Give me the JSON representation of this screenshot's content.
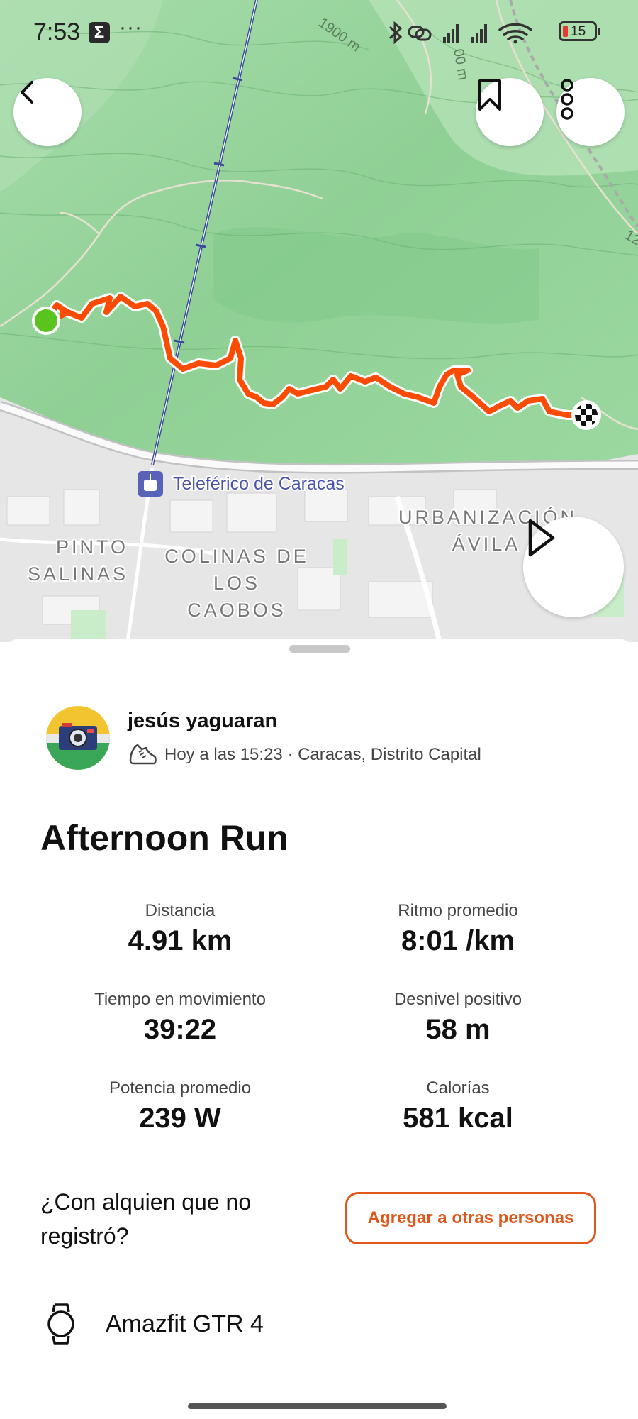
{
  "status_bar": {
    "time": "7:53",
    "notification_icon": "sigma-icon",
    "more": "···",
    "battery_level": "15",
    "icons": [
      "bluetooth-icon",
      "link-icon",
      "signal-icon",
      "signal-icon",
      "wifi-icon",
      "battery-icon"
    ]
  },
  "map": {
    "labels": {
      "teleferico": "Teleférico de Caracas",
      "pinto1": "PINTO",
      "pinto2": "SALINAS",
      "colinas1": "COLINAS DE",
      "colinas2": "LOS",
      "colinas3": "CAOBOS",
      "urb1": "URBANIZACIÓN",
      "urb2": "ÁVILA",
      "contour1": "1900 m",
      "contour2": "00 m",
      "contour3": "12"
    },
    "colors": {
      "route": "#fc4c02",
      "start": "#5ac31d",
      "forest": "#9fd9a2",
      "urban": "#e8e8e8"
    }
  },
  "activity": {
    "user": "jesús yaguaran",
    "meta": "Hoy a las 15:23 · Caracas, Distrito Capital",
    "title": "Afternoon Run",
    "stats": [
      {
        "label": "Distancia",
        "value": "4.91 km"
      },
      {
        "label": "Ritmo promedio",
        "value": "8:01 /km"
      },
      {
        "label": "Tiempo en movimiento",
        "value": "39:22"
      },
      {
        "label": "Desnivel positivo",
        "value": "58 m"
      },
      {
        "label": "Potencia promedio",
        "value": "239 W"
      },
      {
        "label": "Calorías",
        "value": "581 kcal"
      }
    ],
    "question": "¿Con alquien que no registró?",
    "add_button": "Agregar a otras personas",
    "device": "Amazfit GTR 4"
  },
  "accent_color": "#e0561b"
}
